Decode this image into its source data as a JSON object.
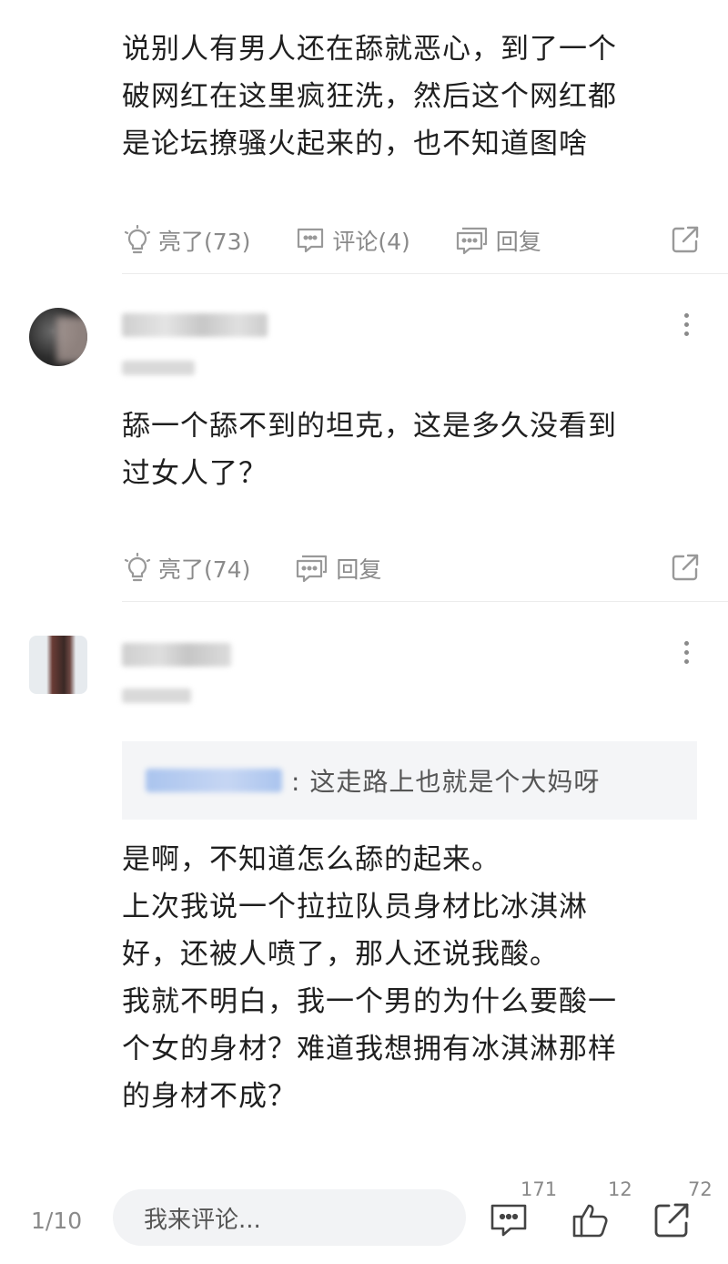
{
  "comments": [
    {
      "text_lines": [
        "说别人有男人还在舔就恶心，到了一个",
        "破网红在这里疯狂洗，然后这个网红都",
        "是论坛撩骚火起来的，也不知道图啥"
      ],
      "like_label": "亮了(73)",
      "comment_label": "评论(4)",
      "reply_label": "回复"
    },
    {
      "text_lines": [
        "舔一个舔不到的坦克，这是多久没看到",
        "过女人了？"
      ],
      "like_label": "亮了(74)",
      "reply_label": "回复"
    },
    {
      "quote_text": ": 这走路上也就是个大妈呀",
      "text_lines": [
        "是啊，不知道怎么舔的起来。",
        "上次我说一个拉拉队员身材比冰淇淋",
        "好，还被人喷了，那人还说我酸。",
        "我就不明白，我一个男的为什么要酸一",
        "个女的身材？难道我想拥有冰淇淋那样",
        "的身材不成？"
      ]
    }
  ],
  "bottom_bar": {
    "page_indicator": "1/10",
    "input_placeholder": "我来评论...",
    "comment_count": "171",
    "like_count": "12",
    "share_count": "72"
  },
  "icons": [
    "bulb-icon",
    "comment-icon",
    "reply-icon",
    "share-icon",
    "more-icon",
    "thumbs-up-icon"
  ],
  "colors": {
    "text": "#1f1f1f",
    "muted": "#8a8a8a",
    "quote_bg": "#f4f5f7",
    "input_bg": "#f2f3f5"
  }
}
